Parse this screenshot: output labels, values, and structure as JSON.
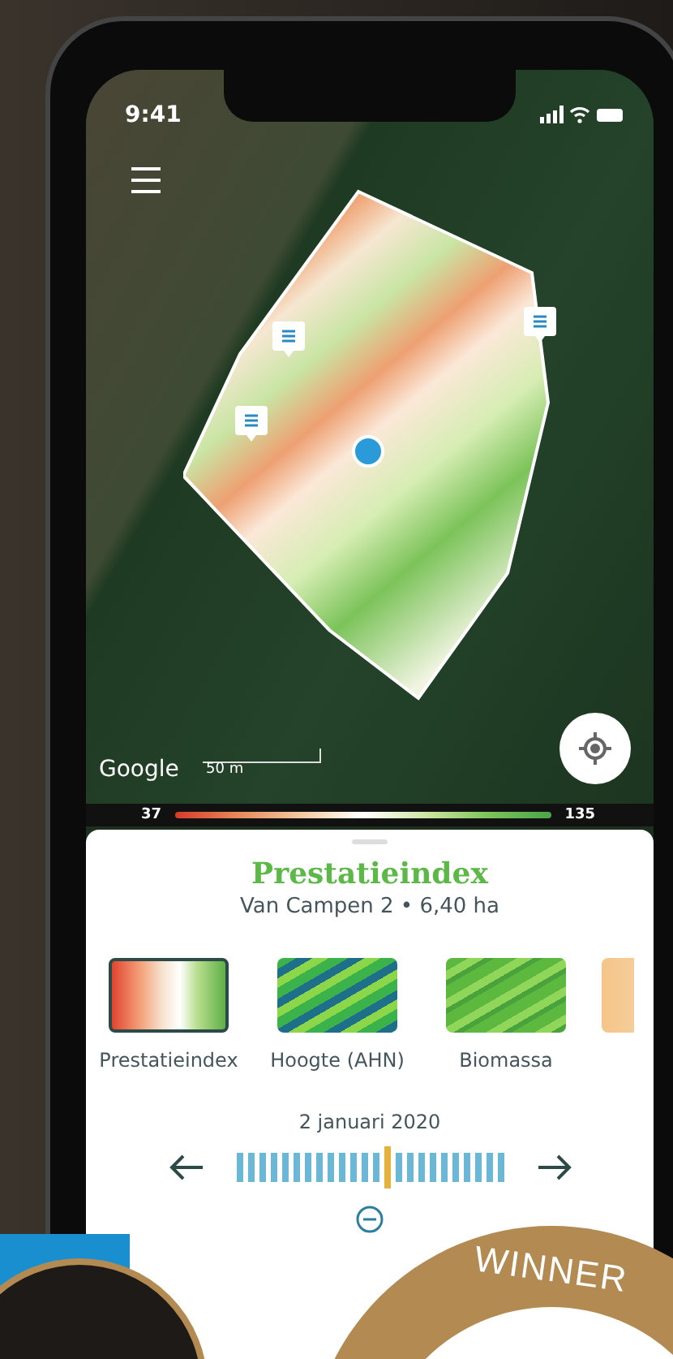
{
  "status_bar": {
    "time": "9:41"
  },
  "map": {
    "attribution": "Google",
    "scale": "50 m"
  },
  "legend": {
    "min": "37",
    "max": "135"
  },
  "sheet": {
    "title": "Prestatieindex",
    "subtitle": "Van Campen 2 • 6,40 ha"
  },
  "layers": [
    {
      "label": "Prestatieindex",
      "kind": "performance",
      "selected": true
    },
    {
      "label": "Hoogte (AHN)",
      "kind": "elevation",
      "selected": false
    },
    {
      "label": "Biomassa",
      "kind": "biomass",
      "selected": false
    },
    {
      "kind": "other",
      "selected": false
    }
  ],
  "timeline": {
    "date": "2 januari 2020",
    "ticks": [
      {
        "selected": false
      },
      {
        "selected": false
      },
      {
        "selected": false
      },
      {
        "selected": false
      },
      {
        "selected": false
      },
      {
        "selected": false
      },
      {
        "selected": false
      },
      {
        "selected": false
      },
      {
        "selected": false
      },
      {
        "selected": false
      },
      {
        "selected": false
      },
      {
        "selected": false
      },
      {
        "selected": false
      },
      {
        "selected": true
      },
      {
        "selected": false
      },
      {
        "selected": false
      },
      {
        "selected": false
      },
      {
        "selected": false
      },
      {
        "selected": false
      },
      {
        "selected": false
      },
      {
        "selected": false
      },
      {
        "selected": false
      },
      {
        "selected": false
      },
      {
        "selected": false
      }
    ]
  },
  "badge": {
    "text": "WINNER"
  }
}
